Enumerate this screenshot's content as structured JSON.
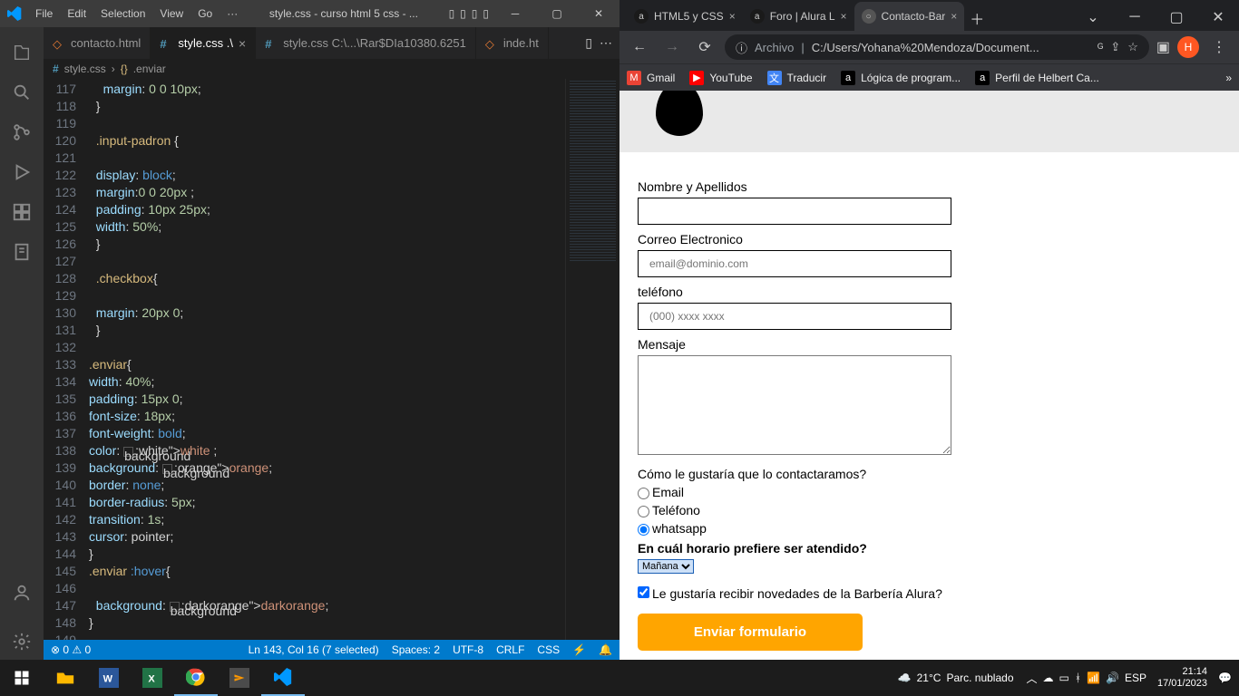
{
  "vscode": {
    "menus": [
      "File",
      "Edit",
      "Selection",
      "View",
      "Go",
      "···"
    ],
    "window_title": "style.css - curso html 5 css - ...",
    "tabs": [
      {
        "icon": "html",
        "label": "contacto.html",
        "active": false,
        "close": false
      },
      {
        "icon": "css",
        "label": "style.css .\\",
        "active": true,
        "close": true
      },
      {
        "icon": "css",
        "label": "style.css  C:\\...\\Rar$DIa10380.6251",
        "active": false,
        "close": false
      },
      {
        "icon": "html",
        "label": "inde.ht",
        "active": false,
        "close": false
      }
    ],
    "breadcrumb": [
      "style.css",
      ".enviar"
    ],
    "line_start": 117,
    "lines": [
      "    margin: 0 0 10px;",
      "  }",
      "",
      "  .input-padron {",
      "",
      "  display: block;",
      "  margin:0 0 20px ;",
      "  padding: 10px 25px;",
      "  width: 50%;",
      "  }",
      "",
      "  .checkbox{",
      "",
      "  margin: 20px 0;",
      "  }",
      "",
      ".enviar{",
      "width: 40%;",
      "padding: 15px 0;",
      "font-size: 18px;",
      "font-weight: bold;",
      "color: ■white ;",
      "background: ■orange;",
      "border: none;",
      "border-radius: 5px;",
      "transition: 1s;",
      "cursor: pointer;",
      "}",
      ".enviar :hover{",
      "",
      "  background: ■darkorange;",
      "}",
      ""
    ],
    "status": {
      "errors": "⊗ 0 ⚠ 0",
      "cursor": "Ln 143, Col 16 (7 selected)",
      "spaces": "Spaces: 2",
      "encoding": "UTF-8",
      "eol": "CRLF",
      "lang": "CSS"
    }
  },
  "browser": {
    "tabs": [
      {
        "favicon": "a",
        "label": "HTML5 y CSS",
        "active": false
      },
      {
        "favicon": "a",
        "label": "Foro | Alura L",
        "active": false
      },
      {
        "favicon": "○",
        "label": "Contacto-Bar",
        "active": true
      }
    ],
    "url_prefix": "Archivo",
    "url": "C:/Users/Yohana%20Mendoza/Document...",
    "avatar": "H",
    "bookmarks": [
      {
        "icon": "M",
        "color": "#ea4335",
        "label": "Gmail"
      },
      {
        "icon": "▶",
        "color": "#ff0000",
        "label": "YouTube"
      },
      {
        "icon": "文",
        "color": "#4285f4",
        "label": "Traducir"
      },
      {
        "icon": "a",
        "color": "#000",
        "label": "Lógica de program..."
      },
      {
        "icon": "a",
        "color": "#000",
        "label": "Perfil de Helbert Ca..."
      }
    ]
  },
  "form": {
    "nombre_label": "Nombre y Apellidos",
    "correo_label": "Correo Electronico",
    "correo_placeholder": "email@dominio.com",
    "telefono_label": "teléfono",
    "telefono_placeholder": "(000) xxxx xxxx",
    "mensaje_label": "Mensaje",
    "contact_question": "Cómo le gustaría que lo contactaramos?",
    "opt_email": "Email",
    "opt_telefono": "Teléfono",
    "opt_whatsapp": "whatsapp",
    "horario_label": "En cuál horario prefiere ser atendido?",
    "horario_option": "Mañana",
    "newsletter": "Le gustaría recibir novedades de la Barbería Alura?",
    "submit": "Enviar formulario"
  },
  "taskbar": {
    "weather_temp": "21°C",
    "weather_desc": "Parc. nublado",
    "lang": "ESP",
    "time": "21:14",
    "date": "17/01/2023"
  }
}
